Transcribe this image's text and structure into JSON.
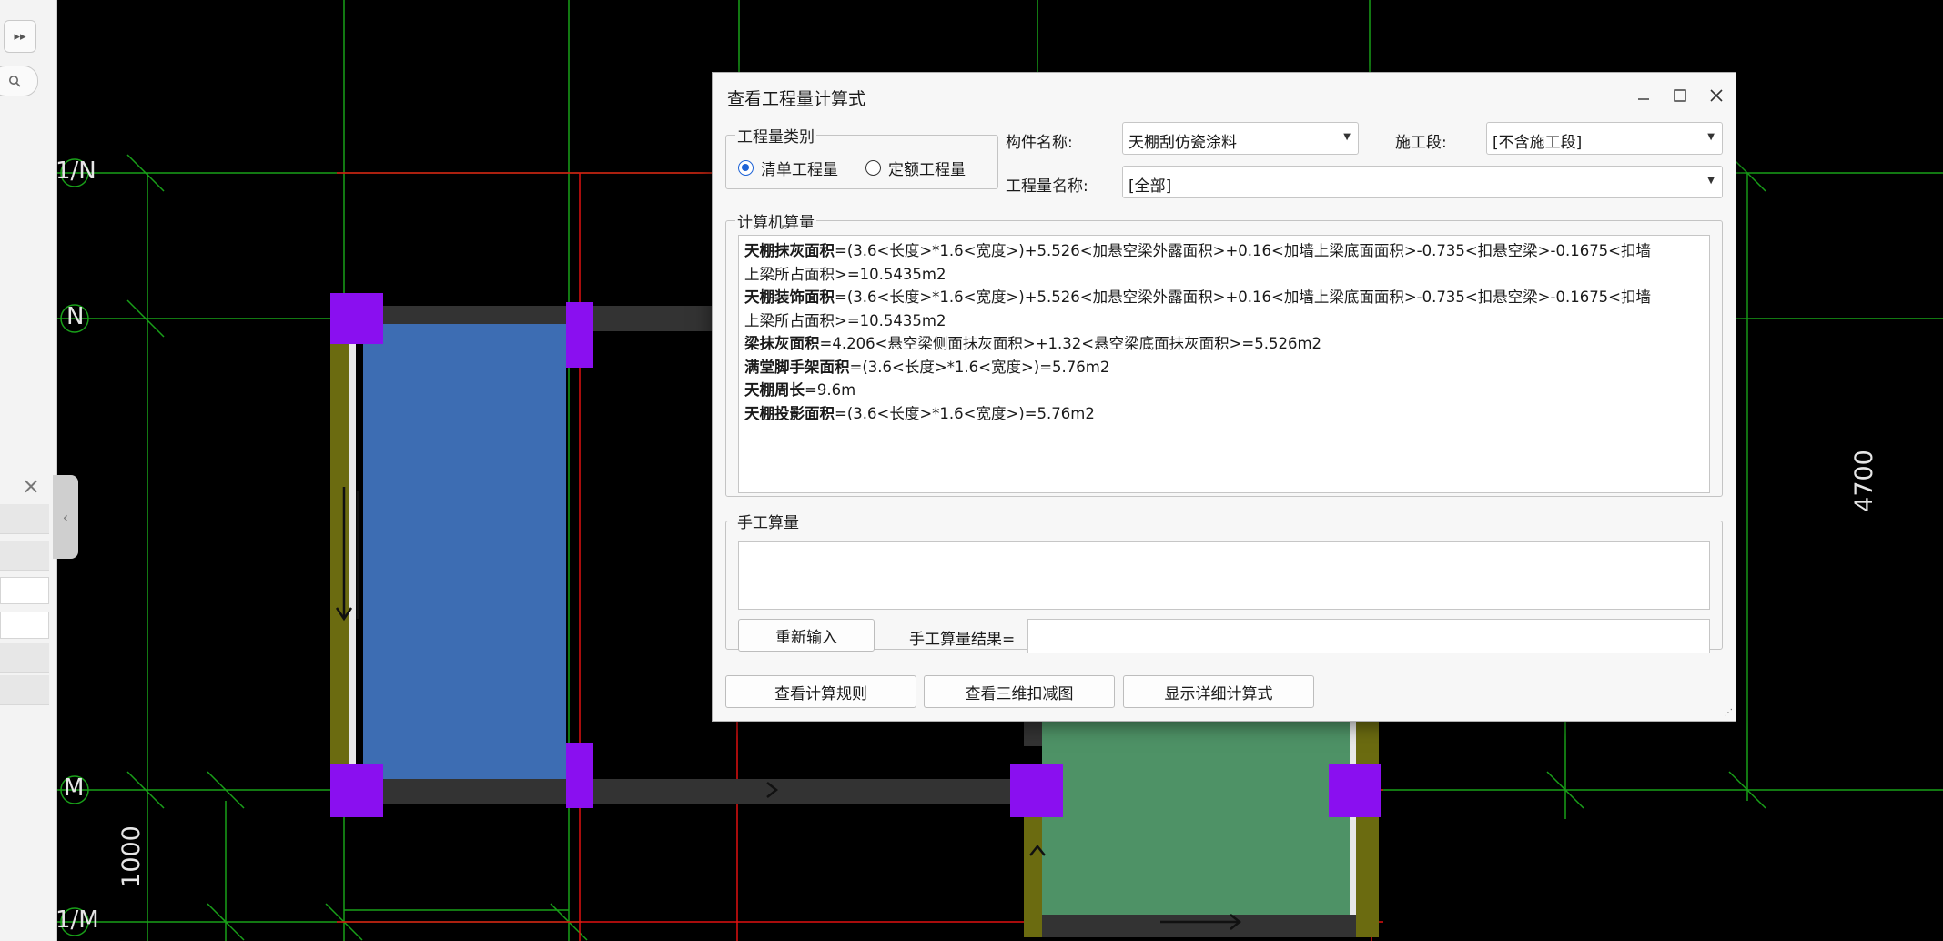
{
  "canvas": {
    "grid_labels": [
      "1/N",
      "N",
      "M",
      "1/M"
    ],
    "dimensions": [
      "4700",
      "1000"
    ]
  },
  "left_panel": {
    "expand_icon": "▸▸",
    "search_icon": "search-icon",
    "close_icon": "×",
    "collapse_icon": "‹"
  },
  "dialog": {
    "title": "查看工程量计算式",
    "quantity_type": {
      "legend": "工程量类别",
      "options": [
        "清单工程量",
        "定额工程量"
      ],
      "selected": "清单工程量"
    },
    "component_name": {
      "label": "构件名称:",
      "value": "天棚刮仿瓷涂料"
    },
    "construction_stage": {
      "label": "施工段:",
      "value": "[不含施工段]"
    },
    "quantity_name": {
      "label": "工程量名称:",
      "value": "[全部]"
    },
    "computer_calc": {
      "legend": "计算机算量",
      "lines": [
        {
          "name": "天棚抹灰面积",
          "formula": "=(3.6<长度>*1.6<宽度>)+5.526<加悬空梁外露面积>+0.16<加墙上梁底面面积>-0.735<扣悬空梁>-0.1675<扣墙",
          "cont": "上梁所占面积>=10.5435m2"
        },
        {
          "name": "天棚装饰面积",
          "formula": "=(3.6<长度>*1.6<宽度>)+5.526<加悬空梁外露面积>+0.16<加墙上梁底面面积>-0.735<扣悬空梁>-0.1675<扣墙",
          "cont": "上梁所占面积>=10.5435m2"
        },
        {
          "name": "梁抹灰面积",
          "formula": "=4.206<悬空梁侧面抹灰面积>+1.32<悬空梁底面抹灰面积>=5.526m2",
          "cont": ""
        },
        {
          "name": "满堂脚手架面积",
          "formula": "=(3.6<长度>*1.6<宽度>)=5.76m2",
          "cont": ""
        },
        {
          "name": "天棚周长",
          "formula": "=9.6m",
          "cont": ""
        },
        {
          "name": "天棚投影面积",
          "formula": "=(3.6<长度>*1.6<宽度>)=5.76m2",
          "cont": ""
        }
      ]
    },
    "manual_calc": {
      "legend": "手工算量",
      "reenter_label": "重新输入",
      "result_label": "手工算量结果=",
      "result_value": ""
    },
    "buttons": {
      "rules": "查看计算规则",
      "view3d": "查看三维扣减图",
      "detail": "显示详细计算式"
    }
  }
}
